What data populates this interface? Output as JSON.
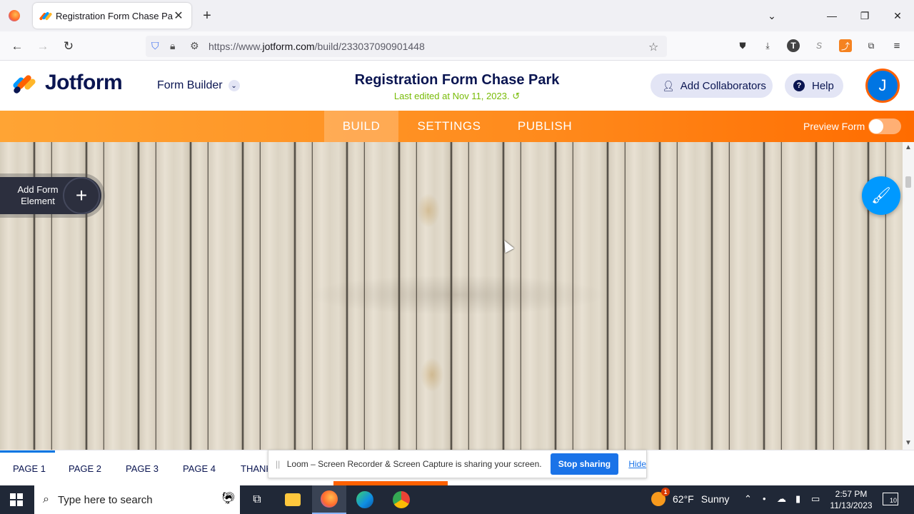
{
  "browser": {
    "tab_title": "Registration Form Chase Park",
    "new_tab": "+",
    "url_prefix": "https://www.",
    "url_domain": "jotform.com",
    "url_path": "/build/233037090901448",
    "window_controls": [
      "minimize",
      "restore",
      "close"
    ],
    "extensions": [
      "pocket-icon",
      "download-icon",
      "T",
      "S",
      "ext-orange-icon",
      "puzzle-icon",
      "menu-icon"
    ]
  },
  "header": {
    "brand": "Jotform",
    "form_builder": "Form Builder",
    "form_title": "Registration Form Chase Park",
    "last_edited": "Last edited at Nov 11, 2023.",
    "collaborators_label": "Add Collaborators",
    "help_label": "Help",
    "avatar_initial": "J"
  },
  "nav": {
    "tabs": [
      {
        "label": "BUILD",
        "active": true
      },
      {
        "label": "SETTINGS",
        "active": false
      },
      {
        "label": "PUBLISH",
        "active": false
      }
    ],
    "preview_label": "Preview Form",
    "preview_enabled": false
  },
  "canvas": {
    "add_element_label": "Add Form Element",
    "add_element_line1": "Add Form",
    "add_element_line2": "Element"
  },
  "pages": {
    "tabs": [
      "PAGE 1",
      "PAGE 2",
      "PAGE 3",
      "PAGE 4",
      "THANK"
    ],
    "active_index": 0
  },
  "loom": {
    "message": "Loom – Screen Recorder & Screen Capture is sharing your screen.",
    "stop_label": "Stop sharing",
    "hide_label": "Hide"
  },
  "taskbar": {
    "search_placeholder": "Type here to search",
    "weather_temp": "62°F",
    "weather_desc": "Sunny",
    "weather_badge": "1",
    "time": "2:57 PM",
    "date": "11/13/2023",
    "notifications": "10"
  },
  "colors": {
    "brand_navy": "#0a1551",
    "brand_orange": "#ff6100",
    "accent_blue": "#0075e3",
    "edited_green": "#78bb07"
  }
}
